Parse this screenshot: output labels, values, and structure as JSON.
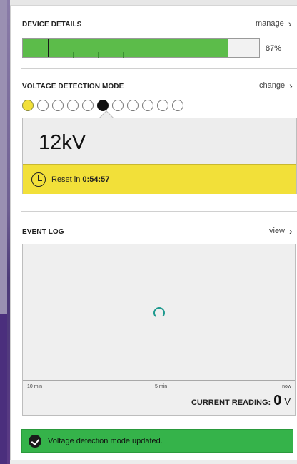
{
  "device_details": {
    "title": "DEVICE DETAILS",
    "action_label": "manage",
    "battery_percent_text": "87%",
    "battery_level": 0.87
  },
  "voltage_mode": {
    "title": "VOLTAGE DETECTION MODE",
    "action_label": "change",
    "selected_index": 5,
    "mode_count": 11,
    "value": "12kV",
    "reset_prefix": "Reset in ",
    "reset_time": "0:54:57"
  },
  "event_log": {
    "title": "EVENT LOG",
    "action_label": "view",
    "axis": [
      "10 min",
      "5 min",
      "now"
    ],
    "reading_label": "CURRENT READING:",
    "reading_value": "0",
    "reading_unit": "V"
  },
  "toast": {
    "message": "Voltage detection mode updated."
  },
  "colors": {
    "battery_green": "#5cbc4a",
    "warning_yellow": "#f2e039",
    "success_green": "#35b34a",
    "spinner_teal": "#1f9a8f"
  },
  "icons": [
    "chevron-right-icon",
    "clock-icon",
    "spinner-icon",
    "check-icon"
  ]
}
